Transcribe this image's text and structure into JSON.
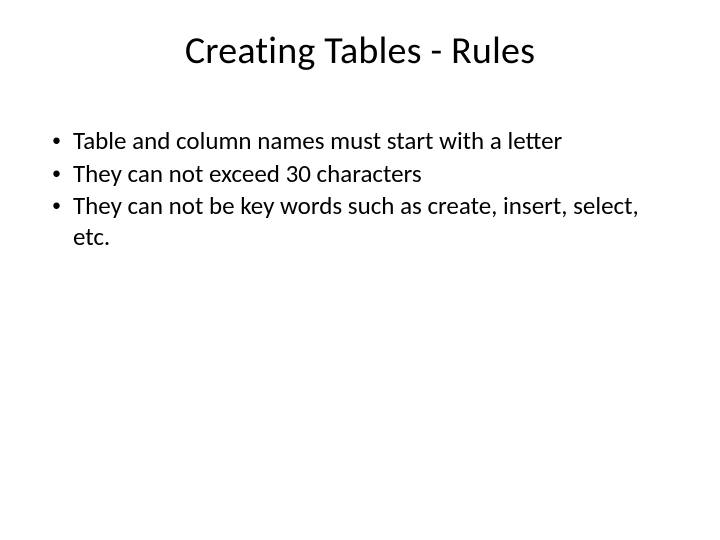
{
  "title": "Creating Tables - Rules",
  "bullets": {
    "item0": "Table and column names must start with a letter",
    "item1": "They can not exceed 30 characters",
    "item2": "They can not be key words such as create, insert, select, etc."
  }
}
